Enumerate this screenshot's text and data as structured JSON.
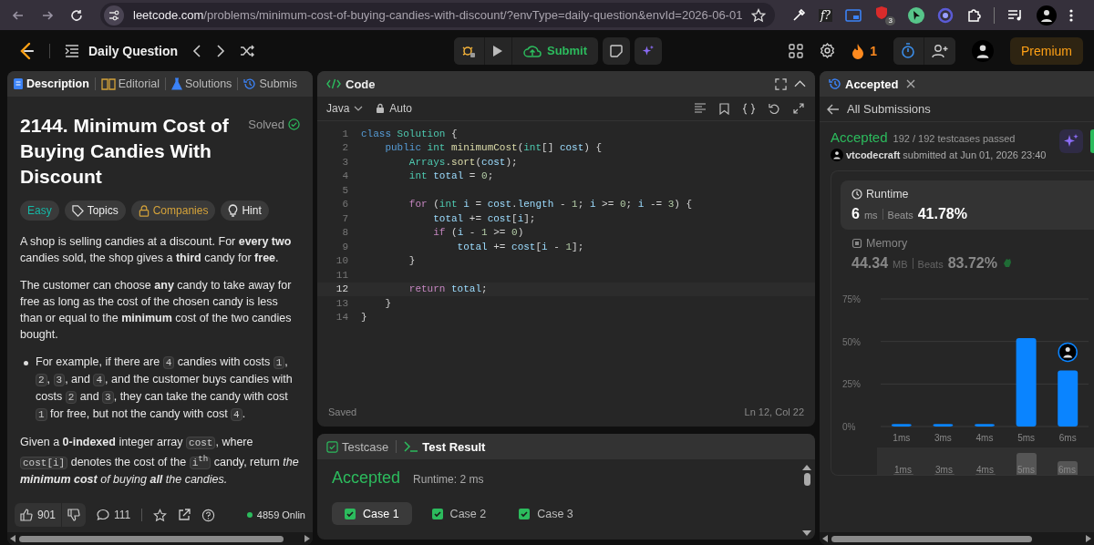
{
  "browser": {
    "url_host": "leetcode.com",
    "url_path": "/problems/minimum-cost-of-buying-candies-with-discount/?envType=daily-question&envId=2026-06-01",
    "extensions": [
      {
        "kind": "eyedropper"
      },
      {
        "kind": "formula",
        "label": "f?"
      },
      {
        "kind": "pip"
      },
      {
        "kind": "shield",
        "badge": "3"
      },
      {
        "kind": "cursor"
      },
      {
        "kind": "ring"
      },
      {
        "kind": "puzzle"
      },
      {
        "kind": "playlist"
      }
    ]
  },
  "nav": {
    "title": "Daily Question",
    "submit": "Submit",
    "streak": "1",
    "premium": "Premium"
  },
  "description": {
    "tabs": [
      {
        "kind": "description",
        "label": "Description",
        "selected": true
      },
      {
        "kind": "editorial",
        "label": "Editorial",
        "selected": false
      },
      {
        "kind": "solutions",
        "label": "Solutions",
        "selected": false
      },
      {
        "kind": "submissions",
        "label": "Submis",
        "selected": false
      }
    ],
    "title": "2144. Minimum Cost of Buying Candies With Discount",
    "status": "Solved",
    "tags": [
      {
        "kind": "difficulty",
        "label": "Easy"
      },
      {
        "kind": "topics",
        "label": "Topics"
      },
      {
        "kind": "companies",
        "label": "Companies"
      },
      {
        "kind": "hint",
        "label": "Hint"
      }
    ],
    "paragraphs": [
      {
        "kind": "text",
        "segments": [
          {
            "kind": "text",
            "text": "A shop is selling candies at a discount. For **every two** candies sold, the shop gives a **third** candy for **free**."
          }
        ]
      },
      {
        "kind": "text",
        "segments": [
          {
            "kind": "text",
            "text": "The customer can choose **any** candy to take away for free as long as the cost of the chosen candy is less than or equal to the **minimum** cost of the two candies bought."
          }
        ]
      },
      {
        "kind": "bullet",
        "segments": [
          {
            "kind": "text",
            "text": "For example, if there are "
          },
          {
            "kind": "code",
            "text": "4"
          },
          {
            "kind": "text",
            "text": " candies with costs "
          },
          {
            "kind": "code",
            "text": "1"
          },
          {
            "kind": "text",
            "text": ", "
          },
          {
            "kind": "code",
            "text": "2"
          },
          {
            "kind": "text",
            "text": ", "
          },
          {
            "kind": "code",
            "text": "3"
          },
          {
            "kind": "text",
            "text": ", and "
          },
          {
            "kind": "code",
            "text": "4"
          },
          {
            "kind": "text",
            "text": ", and the customer buys candies with costs "
          },
          {
            "kind": "code",
            "text": "2"
          },
          {
            "kind": "text",
            "text": " and "
          },
          {
            "kind": "code",
            "text": "3"
          },
          {
            "kind": "text",
            "text": ", they can take the candy with cost "
          },
          {
            "kind": "code",
            "text": "1"
          },
          {
            "kind": "text",
            "text": " for free, but not the candy with cost "
          },
          {
            "kind": "code",
            "text": "4"
          },
          {
            "kind": "text",
            "text": "."
          }
        ]
      },
      {
        "kind": "text",
        "segments": [
          {
            "kind": "text",
            "text": "Given a **0-indexed** integer array "
          },
          {
            "kind": "code",
            "text": "cost"
          },
          {
            "kind": "text",
            "text": ", where "
          },
          {
            "kind": "code",
            "text": "cost[i]"
          },
          {
            "kind": "text",
            "text": " denotes the cost of the "
          },
          {
            "kind": "code",
            "text": "i$^{th}$"
          },
          {
            "kind": "text",
            "text": " candy, return "
          },
          {
            "kind": "em",
            "text": "the **minimum cost** of buying **all** the candies."
          }
        ]
      }
    ],
    "likes": "901",
    "comments": "111",
    "online": "4859 Onlin"
  },
  "code": {
    "title": "Code",
    "language": "Java",
    "mode": "Auto",
    "status": "Saved",
    "cursor": "Ln 12, Col 22",
    "lines": [
      {
        "number": "1",
        "current": false,
        "tokens": [
          {
            "kind": "kw",
            "text": "class"
          },
          {
            "kind": "ty",
            "text": " Solution"
          },
          {
            "kind": "p",
            "text": " {"
          }
        ]
      },
      {
        "number": "2",
        "current": false,
        "tokens": [
          {
            "kind": "kw",
            "text": "    public"
          },
          {
            "kind": "ty",
            "text": " int"
          },
          {
            "kind": "fn",
            "text": " minimumCost"
          },
          {
            "kind": "p",
            "text": "("
          },
          {
            "kind": "ty",
            "text": "int"
          },
          {
            "kind": "p",
            "text": "[] "
          },
          {
            "kind": "var",
            "text": "cost"
          },
          {
            "kind": "p",
            "text": ") {"
          }
        ]
      },
      {
        "number": "3",
        "current": false,
        "tokens": [
          {
            "kind": "ty",
            "text": "        Arrays"
          },
          {
            "kind": "p",
            "text": "."
          },
          {
            "kind": "fn",
            "text": "sort"
          },
          {
            "kind": "p",
            "text": "("
          },
          {
            "kind": "var",
            "text": "cost"
          },
          {
            "kind": "p",
            "text": ");"
          }
        ]
      },
      {
        "number": "4",
        "current": false,
        "tokens": [
          {
            "kind": "ty",
            "text": "        int"
          },
          {
            "kind": "var",
            "text": " total"
          },
          {
            "kind": "p",
            "text": " = "
          },
          {
            "kind": "num",
            "text": "0"
          },
          {
            "kind": "p",
            "text": ";"
          }
        ]
      },
      {
        "number": "5",
        "current": false
      },
      {
        "number": "6",
        "current": false,
        "tokens": [
          {
            "kind": "ctl",
            "text": "        for"
          },
          {
            "kind": "p",
            "text": " ("
          },
          {
            "kind": "ty",
            "text": "int"
          },
          {
            "kind": "var",
            "text": " i"
          },
          {
            "kind": "p",
            "text": " = "
          },
          {
            "kind": "var",
            "text": "cost"
          },
          {
            "kind": "p",
            "text": "."
          },
          {
            "kind": "var",
            "text": "length"
          },
          {
            "kind": "p",
            "text": " - "
          },
          {
            "kind": "num",
            "text": "1"
          },
          {
            "kind": "p",
            "text": "; "
          },
          {
            "kind": "var",
            "text": "i"
          },
          {
            "kind": "p",
            "text": " >= "
          },
          {
            "kind": "num",
            "text": "0"
          },
          {
            "kind": "p",
            "text": "; "
          },
          {
            "kind": "var",
            "text": "i"
          },
          {
            "kind": "p",
            "text": " -= "
          },
          {
            "kind": "num",
            "text": "3"
          },
          {
            "kind": "p",
            "text": ") {"
          }
        ]
      },
      {
        "number": "7",
        "current": false,
        "tokens": [
          {
            "kind": "var",
            "text": "            total"
          },
          {
            "kind": "p",
            "text": " += "
          },
          {
            "kind": "var",
            "text": "cost"
          },
          {
            "kind": "p",
            "text": "["
          },
          {
            "kind": "var",
            "text": "i"
          },
          {
            "kind": "p",
            "text": "];"
          }
        ]
      },
      {
        "number": "8",
        "current": false,
        "tokens": [
          {
            "kind": "ctl",
            "text": "            if"
          },
          {
            "kind": "p",
            "text": " ("
          },
          {
            "kind": "var",
            "text": "i"
          },
          {
            "kind": "p",
            "text": " - "
          },
          {
            "kind": "num",
            "text": "1"
          },
          {
            "kind": "p",
            "text": " >= "
          },
          {
            "kind": "num",
            "text": "0"
          },
          {
            "kind": "p",
            "text": ")"
          }
        ]
      },
      {
        "number": "9",
        "current": false,
        "tokens": [
          {
            "kind": "var",
            "text": "                total"
          },
          {
            "kind": "p",
            "text": " += "
          },
          {
            "kind": "var",
            "text": "cost"
          },
          {
            "kind": "p",
            "text": "["
          },
          {
            "kind": "var",
            "text": "i"
          },
          {
            "kind": "p",
            "text": " - "
          },
          {
            "kind": "num",
            "text": "1"
          },
          {
            "kind": "p",
            "text": "];"
          }
        ]
      },
      {
        "number": "10",
        "current": false,
        "tokens": [
          {
            "kind": "p",
            "text": "        }"
          }
        ]
      },
      {
        "number": "11",
        "current": false
      },
      {
        "number": "12",
        "current": true,
        "tokens": [
          {
            "kind": "ctl",
            "text": "        return"
          },
          {
            "kind": "var",
            "text": " total"
          },
          {
            "kind": "p",
            "text": ";"
          }
        ]
      },
      {
        "number": "13",
        "current": false,
        "tokens": [
          {
            "kind": "p",
            "text": "    }"
          }
        ]
      },
      {
        "number": "14",
        "current": false,
        "tokens": [
          {
            "kind": "p",
            "text": "}"
          }
        ]
      }
    ]
  },
  "tests": {
    "tabs": [
      {
        "kind": "testcase",
        "label": "Testcase",
        "selected": false
      },
      {
        "kind": "result",
        "label": "Test Result",
        "selected": true
      }
    ],
    "verdict": "Accepted",
    "runtime": "Runtime: 2 ms",
    "cases": [
      {
        "label": "Case 1",
        "selected": true,
        "passed": true
      },
      {
        "label": "Case 2",
        "selected": false,
        "passed": true
      },
      {
        "label": "Case 3",
        "selected": false,
        "passed": true
      }
    ]
  },
  "submission": {
    "tab": "Accepted",
    "back": "All Submissions",
    "verdict": "Accepted",
    "testcases": "192 / 192 testcases passed",
    "user": "vtcodecraft",
    "submitted": "submitted at Jun 01, 2026 23:40",
    "metrics": [
      {
        "kind": "runtime",
        "label": "Runtime",
        "value": "6",
        "unit": "ms",
        "beats_label": "Beats",
        "beats": "41.78%",
        "selected": true
      },
      {
        "kind": "memory",
        "label": "Memory",
        "value": "44.34",
        "unit": "MB",
        "beats_label": "Beats",
        "beats": "83.72%",
        "selected": false
      }
    ],
    "chart_data": {
      "type": "bar",
      "categories": [
        "1ms",
        "3ms",
        "4ms",
        "5ms",
        "6ms"
      ],
      "values": [
        1.5,
        1.5,
        1.5,
        52,
        33
      ],
      "ylim": [
        0,
        75
      ],
      "yticks": [
        {
          "value": 0,
          "label": "0%"
        },
        {
          "value": 25,
          "label": "25%"
        },
        {
          "value": 50,
          "label": "50%"
        },
        {
          "value": 75,
          "label": "75%"
        }
      ]
    },
    "brush_labels": [
      "1ms",
      "3ms",
      "4ms",
      "5ms",
      "6ms"
    ]
  }
}
